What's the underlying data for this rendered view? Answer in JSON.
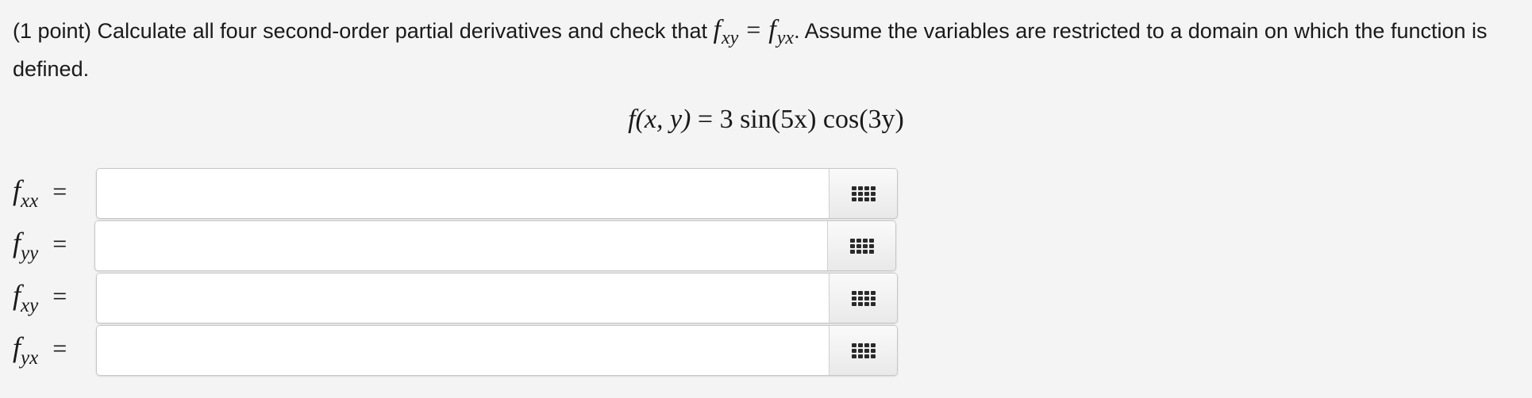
{
  "problem": {
    "intro": "(1 point) Calculate all four second-order partial derivatives and check that",
    "check_lhs_symbol": "f",
    "check_lhs_sub": "xy",
    "check_eq": "=",
    "check_rhs_symbol": "f",
    "check_rhs_sub": "yx",
    "rest": ". Assume the variables are restricted to a domain on which the function is defined."
  },
  "function": {
    "lhs": "f(x, y)",
    "eq": "=",
    "rhs": "3 sin(5x) cos(3y)"
  },
  "answers": [
    {
      "symbol": "f",
      "sub": "xx",
      "eq": "=",
      "value": "",
      "palette_icon": "grid-icon"
    },
    {
      "symbol": "f",
      "sub": "yy",
      "eq": "=",
      "value": "",
      "palette_icon": "grid-icon"
    },
    {
      "symbol": "f",
      "sub": "xy",
      "eq": "=",
      "value": "",
      "palette_icon": "grid-icon"
    },
    {
      "symbol": "f",
      "sub": "yx",
      "eq": "=",
      "value": "",
      "palette_icon": "grid-icon"
    }
  ]
}
